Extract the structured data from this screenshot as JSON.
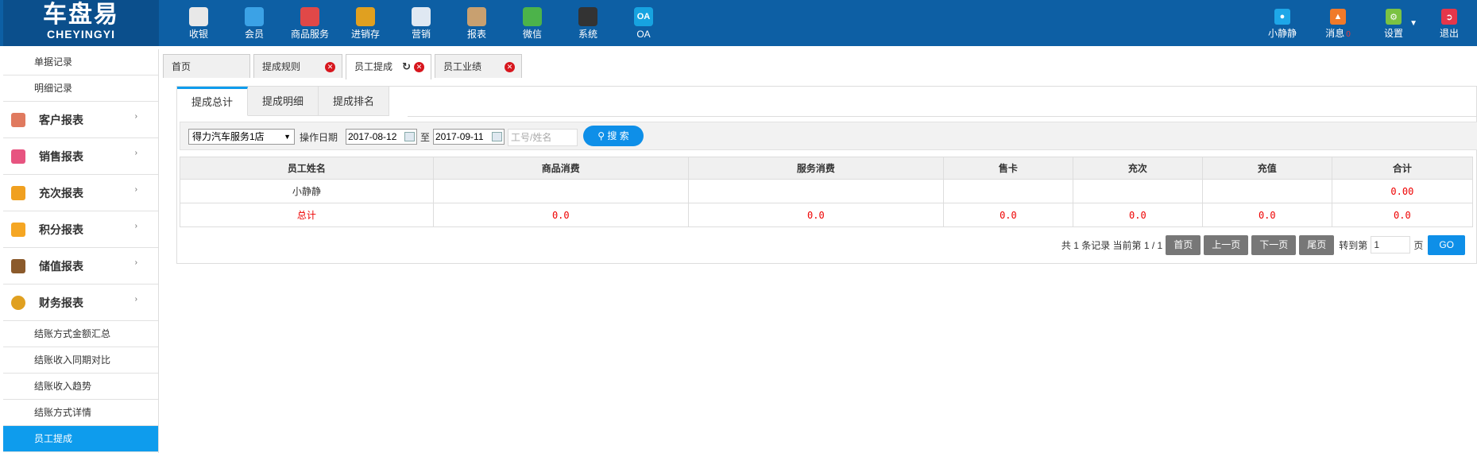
{
  "logo": {
    "cn": "车盘易",
    "en": "CHEYINGYI"
  },
  "nav": [
    {
      "label": "收银",
      "icon": "cash-register-icon",
      "color": "#e8e8e8"
    },
    {
      "label": "会员",
      "icon": "member-icon",
      "color": "#3ba2e6"
    },
    {
      "label": "商品服务",
      "icon": "goods-icon",
      "color": "#e04848"
    },
    {
      "label": "进销存",
      "icon": "inventory-icon",
      "color": "#e0a020"
    },
    {
      "label": "营销",
      "icon": "megaphone-icon",
      "color": "#dfe8f2"
    },
    {
      "label": "报表",
      "icon": "report-icon",
      "color": "#c8a070"
    },
    {
      "label": "微信",
      "icon": "wechat-icon",
      "color": "#4cb34a"
    },
    {
      "label": "系统",
      "icon": "monitor-icon",
      "color": "#333333"
    },
    {
      "label": "OA",
      "icon": "oa-icon",
      "color": "#17a3e0",
      "glyph": "OA"
    }
  ],
  "right_nav": {
    "user": {
      "label": "小静静",
      "icon": "user-icon",
      "color": "#1ea7e8"
    },
    "msg": {
      "label": "消息",
      "badge": "0",
      "icon": "bell-icon",
      "color": "#f07a2a"
    },
    "settings": {
      "label": "设置",
      "icon": "gear-icon",
      "color": "#7bc243"
    },
    "logout": {
      "label": "退出",
      "icon": "logout-icon",
      "color": "#e5364a"
    }
  },
  "sidebar": {
    "top_items": [
      "单据记录",
      "明细记录"
    ],
    "menus": [
      {
        "label": "客户报表",
        "icon": "customer-icon",
        "color": "#e07a5f"
      },
      {
        "label": "销售报表",
        "icon": "sales-icon",
        "color": "#e75480"
      },
      {
        "label": "充次报表",
        "icon": "recharge-count-icon",
        "color": "#f0a020"
      },
      {
        "label": "积分报表",
        "icon": "points-tag-icon",
        "color": "#f5a623"
      },
      {
        "label": "储值报表",
        "icon": "wallet-icon",
        "color": "#8b5a2b"
      },
      {
        "label": "财务报表",
        "icon": "coin-icon",
        "color": "#e0a020"
      }
    ],
    "sub_items": [
      "结账方式金额汇总",
      "结账收入同期对比",
      "结账收入趋势",
      "结账方式详情",
      "员工提成"
    ]
  },
  "tabs": [
    {
      "label": "首页",
      "closable": false
    },
    {
      "label": "提成规则",
      "closable": true
    },
    {
      "label": "员工提成",
      "closable": true,
      "active": true
    },
    {
      "label": "员工业绩",
      "closable": true
    }
  ],
  "inner_tabs": [
    "提成总计",
    "提成明细",
    "提成排名"
  ],
  "filter": {
    "store": "得力汽车服务1店",
    "date_label": "操作日期",
    "date_from": "2017-08-12",
    "to_label": "至",
    "date_to": "2017-09-11",
    "keyword_placeholder": "工号/姓名",
    "search_label": "搜 索"
  },
  "table": {
    "headers": [
      "员工姓名",
      "商品消费",
      "服务消费",
      "售卡",
      "充次",
      "充值",
      "合计"
    ],
    "rows": [
      [
        "小静静",
        "",
        "",
        "",
        "",
        "",
        "0.00"
      ]
    ],
    "total": [
      "总计",
      "0.0",
      "0.0",
      "0.0",
      "0.0",
      "0.0",
      "0.0"
    ]
  },
  "pager": {
    "info": "共 1 条记录 当前第 1 / 1",
    "first": "首页",
    "prev": "上一页",
    "next": "下一页",
    "last": "尾页",
    "goto_label": "转到第",
    "page_value": "1",
    "page_unit": "页",
    "go": "GO"
  }
}
